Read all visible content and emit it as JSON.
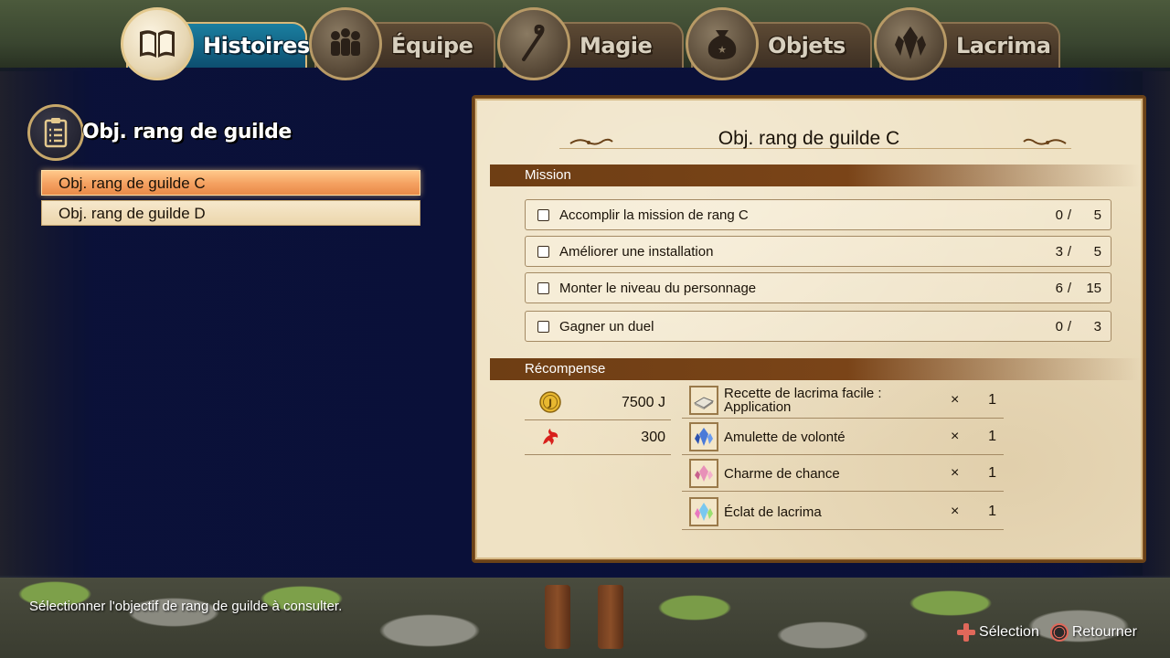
{
  "tabs": [
    {
      "label": "Histoires",
      "icon": "book-icon",
      "active": true
    },
    {
      "label": "Équipe",
      "icon": "team-icon",
      "active": false
    },
    {
      "label": "Magie",
      "icon": "staff-icon",
      "active": false
    },
    {
      "label": "Objets",
      "icon": "bag-icon",
      "active": false
    },
    {
      "label": "Lacrima",
      "icon": "crystal-icon",
      "active": false
    }
  ],
  "sidebar": {
    "title": "Obj. rang de guilde",
    "items": [
      {
        "label": "Obj. rang de guilde C",
        "selected": true
      },
      {
        "label": "Obj. rang de guilde D",
        "selected": false
      }
    ]
  },
  "detail": {
    "title": "Obj. rang de guilde C",
    "mission_header": "Mission",
    "missions": [
      {
        "label": "Accomplir la mission de rang C",
        "current": "0",
        "total": "5",
        "done": false
      },
      {
        "label": "Améliorer une installation",
        "current": "3",
        "total": "5",
        "done": false
      },
      {
        "label": "Monter le niveau du personnage",
        "current": "6",
        "total": "15",
        "done": false
      },
      {
        "label": "Gagner un duel",
        "current": "0",
        "total": "3",
        "done": false
      }
    ],
    "reward_header": "Récompense",
    "currency": [
      {
        "icon": "jewel-coin-icon",
        "value": "7500 J"
      },
      {
        "icon": "fairy-tail-emblem-icon",
        "value": "300"
      }
    ],
    "rewards": [
      {
        "icon": "recipe-book-icon",
        "name": "Recette de lacrima facile : Application",
        "times": "×",
        "qty": "1"
      },
      {
        "icon": "blue-crystal-icon",
        "name": "Amulette de volonté",
        "times": "×",
        "qty": "1"
      },
      {
        "icon": "pink-crystal-icon",
        "name": "Charme de chance",
        "times": "×",
        "qty": "1"
      },
      {
        "icon": "rainbow-crystal-icon",
        "name": "Éclat de lacrima",
        "times": "×",
        "qty": "1"
      }
    ]
  },
  "footer": {
    "help": "Sélectionner l'objectif de rang de guilde à consulter.",
    "select_label": "Sélection",
    "back_label": "Retourner"
  }
}
